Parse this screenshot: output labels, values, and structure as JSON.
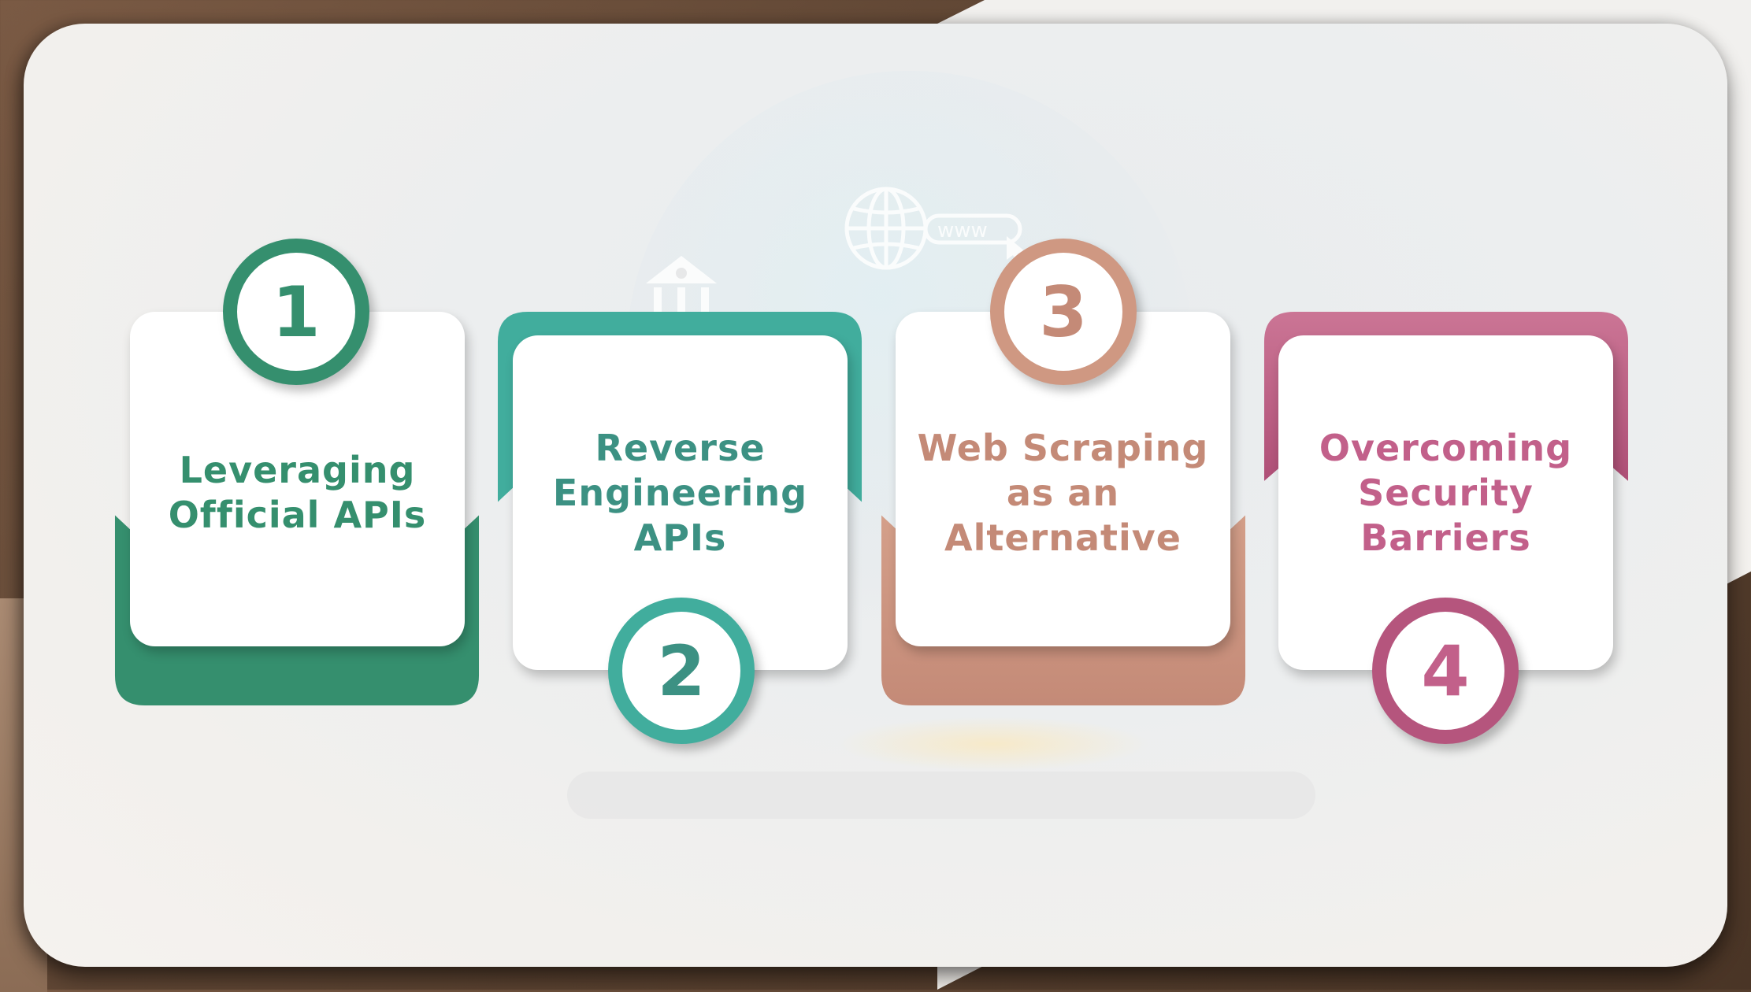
{
  "steps": [
    {
      "number": "1",
      "title": "Leveraging Official APIs",
      "lines": [
        "Leveraging",
        "Official APIs"
      ],
      "color": "#358f6e",
      "color_light": "#3a9a77"
    },
    {
      "number": "2",
      "title": "Reverse Engineering APIs",
      "lines": [
        "Reverse",
        "Engineering",
        "APIs"
      ],
      "color": "#3c9f92",
      "color_light": "#41ad9d"
    },
    {
      "number": "3",
      "title": "Web Scraping as an Alternative",
      "lines": [
        "Web Scraping",
        "as an",
        "Alternative"
      ],
      "color": "#c48a77",
      "color_light": "#d49f89"
    },
    {
      "number": "4",
      "title": "Overcoming Security Barriers",
      "lines": [
        "Overcoming",
        "Security",
        "Barriers"
      ],
      "color": "#a8466f",
      "color_light": "#c96f93"
    }
  ],
  "background": {
    "icons": [
      "globe-www-icon",
      "bank-icon"
    ],
    "www_label": "www"
  }
}
